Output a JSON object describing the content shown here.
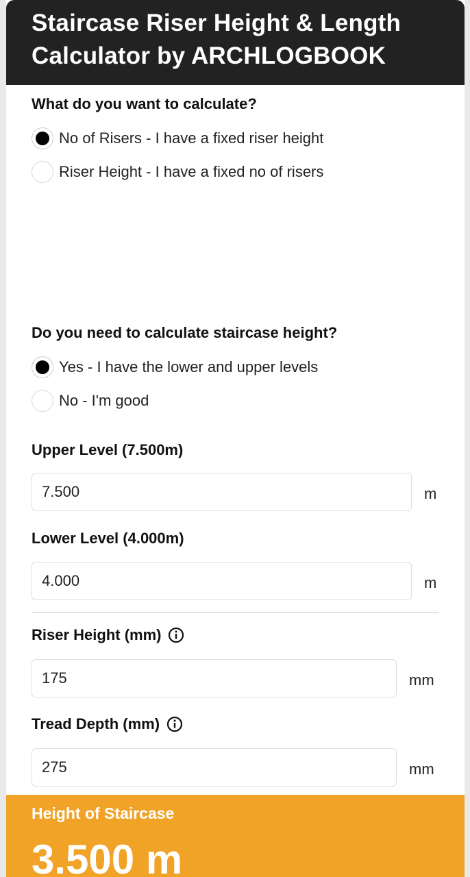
{
  "header": {
    "title_line1": "Staircase Riser Height & Length",
    "title_line2": "Calculator by ARCHLOGBOOK"
  },
  "calc_mode": {
    "question": "What do you want to calculate?",
    "options": [
      {
        "label": "No of Risers - I have a fixed riser height",
        "selected": true
      },
      {
        "label": "Riser Height - I have a fixed no of risers",
        "selected": false
      }
    ]
  },
  "height_mode": {
    "question": "Do you need to calculate staircase height?",
    "options": [
      {
        "label": "Yes - I have the lower and upper levels",
        "selected": true
      },
      {
        "label": "No - I'm good",
        "selected": false
      }
    ]
  },
  "fields": {
    "upper_level": {
      "label": "Upper Level (7.500m)",
      "value": "7.500",
      "unit": "m"
    },
    "lower_level": {
      "label": "Lower Level (4.000m)",
      "value": "4.000",
      "unit": "m"
    },
    "riser_height": {
      "label": "Riser Height (mm)",
      "value": "175",
      "unit": "mm",
      "icon": "info-icon"
    },
    "tread_depth": {
      "label": "Tread Depth (mm)",
      "value": "275",
      "unit": "mm",
      "icon": "info-icon"
    }
  },
  "result": {
    "label": "Height of Staircase",
    "value": "3.500 m"
  },
  "colors": {
    "header_bg": "#222222",
    "result_bg": "#f1a328",
    "radio_selected": "#000000"
  }
}
